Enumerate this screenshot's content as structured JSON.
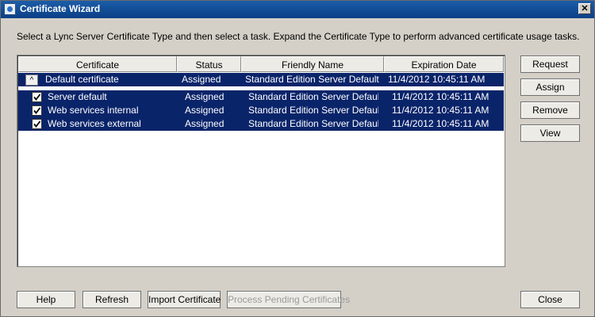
{
  "window": {
    "title": "Certificate Wizard",
    "close_glyph": "✕"
  },
  "instruction": "Select a Lync Server Certificate Type and then select a task. Expand the Certificate Type to perform advanced certificate usage tasks.",
  "table": {
    "columns": [
      "Certificate",
      "Status",
      "Friendly Name",
      "Expiration Date"
    ],
    "group": {
      "expander_glyph": "^",
      "certificate": "Default certificate",
      "status": "Assigned",
      "friendly_name": "Standard Edition Server Default Ce",
      "expiration": "11/4/2012 10:45:11 AM"
    },
    "rows": [
      {
        "certificate": "Server default",
        "status": "Assigned",
        "friendly_name": "Standard Edition Server Default C",
        "expiration": "11/4/2012 10:45:11 AM",
        "checked": true
      },
      {
        "certificate": "Web services internal",
        "status": "Assigned",
        "friendly_name": "Standard Edition Server Default C",
        "expiration": "11/4/2012 10:45:11 AM",
        "checked": true
      },
      {
        "certificate": "Web services external",
        "status": "Assigned",
        "friendly_name": "Standard Edition Server Default C",
        "expiration": "11/4/2012 10:45:11 AM",
        "checked": true
      }
    ]
  },
  "side_buttons": {
    "request": "Request",
    "assign": "Assign",
    "remove": "Remove",
    "view": "View"
  },
  "bottom_buttons": {
    "help": "Help",
    "refresh": "Refresh",
    "import": "Import Certificate",
    "process_pending": "Process Pending Certificates",
    "close": "Close"
  },
  "colors": {
    "titlebar": "#0b3f86",
    "selection": "#0a246a",
    "dialog_bg": "#d4d0c8"
  }
}
